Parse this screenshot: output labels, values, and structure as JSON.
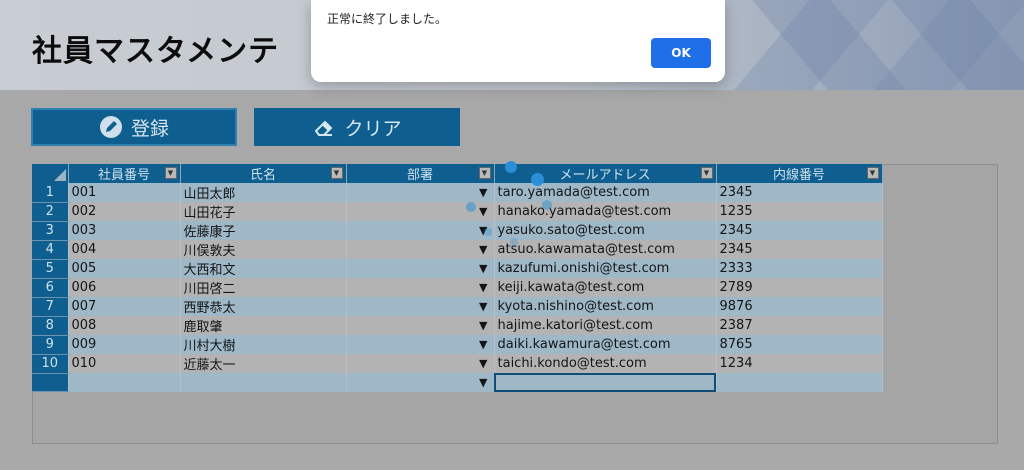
{
  "header": {
    "title": "社員マスタメンテ"
  },
  "toolbar": {
    "register_label": "登録",
    "clear_label": "クリア"
  },
  "grid": {
    "columns": [
      "社員番号",
      "氏名",
      "部署",
      "メールアドレス",
      "内線番号"
    ],
    "rows": [
      {
        "num": "1",
        "id": "001",
        "name": "山田太郎",
        "dept": "▼",
        "email": "taro.yamada@test.com",
        "ext": "2345"
      },
      {
        "num": "2",
        "id": "002",
        "name": "山田花子",
        "dept": "▼",
        "email": "hanako.yamada@test.com",
        "ext": "1235"
      },
      {
        "num": "3",
        "id": "003",
        "name": "佐藤康子",
        "dept": "▼",
        "email": "yasuko.sato@test.com",
        "ext": "2345"
      },
      {
        "num": "4",
        "id": "004",
        "name": "川俣敦夫",
        "dept": "▼",
        "email": "atsuo.kawamata@test.com",
        "ext": "2345"
      },
      {
        "num": "5",
        "id": "005",
        "name": "大西和文",
        "dept": "▼",
        "email": "kazufumi.onishi@test.com",
        "ext": "2333"
      },
      {
        "num": "6",
        "id": "006",
        "name": "川田啓二",
        "dept": "▼",
        "email": "keiji.kawata@test.com",
        "ext": "2789"
      },
      {
        "num": "7",
        "id": "007",
        "name": "西野恭太",
        "dept": "▼",
        "email": "kyota.nishino@test.com",
        "ext": "9876"
      },
      {
        "num": "8",
        "id": "008",
        "name": "鹿取肇",
        "dept": "▼",
        "email": "hajime.katori@test.com",
        "ext": "2387"
      },
      {
        "num": "9",
        "id": "009",
        "name": "川村大樹",
        "dept": "▼",
        "email": "daiki.kawamura@test.com",
        "ext": "8765"
      },
      {
        "num": "10",
        "id": "010",
        "name": "近藤太一",
        "dept": "▼",
        "email": "taichi.kondo@test.com",
        "ext": "1234"
      },
      {
        "num": "",
        "id": "",
        "name": "",
        "dept": "▼",
        "email": "",
        "ext": ""
      }
    ]
  },
  "dialog": {
    "message": "正常に終了しました。",
    "ok_label": "OK"
  },
  "colors": {
    "accent": "#0e5f8f",
    "ok_button": "#1f6fe8"
  }
}
